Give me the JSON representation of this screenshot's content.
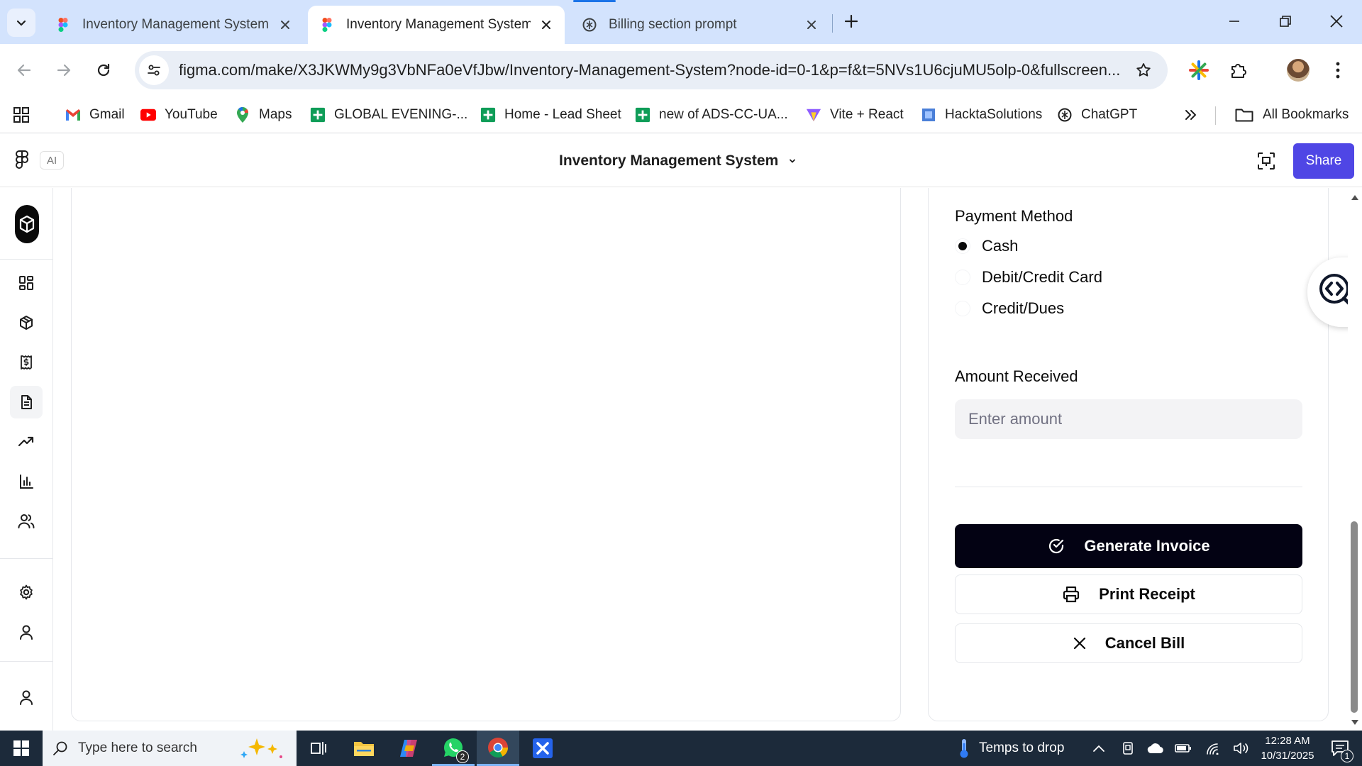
{
  "browser": {
    "tabs": [
      {
        "title": "Inventory Management System",
        "favicon": "figma-icon",
        "active": false
      },
      {
        "title": "Inventory Management System",
        "favicon": "figma-icon",
        "active": true
      },
      {
        "title": "Billing section prompt",
        "favicon": "chatgpt-icon",
        "active": false
      }
    ],
    "url": "figma.com/make/X3JKWMy9g3VbNFa0eVfJbw/Inventory-Management-System?node-id=0-1&p=f&t=5NVs1U6cjuMU5olp-0&fullscreen...",
    "bookmarks": [
      {
        "label": "Gmail",
        "icon": "gmail-icon"
      },
      {
        "label": "YouTube",
        "icon": "youtube-icon"
      },
      {
        "label": "Maps",
        "icon": "maps-icon"
      },
      {
        "label": "GLOBAL EVENING-...",
        "icon": "sheets-icon"
      },
      {
        "label": "Home - Lead Sheet",
        "icon": "sheets-icon"
      },
      {
        "label": "new of ADS-CC-UA...",
        "icon": "sheets-icon"
      },
      {
        "label": "Vite + React",
        "icon": "vite-icon"
      },
      {
        "label": "HacktaSolutions",
        "icon": "hackta-icon"
      },
      {
        "label": "ChatGPT",
        "icon": "chatgpt-icon"
      }
    ],
    "all_bookmarks_label": "All Bookmarks"
  },
  "figma": {
    "ai_badge": "AI",
    "project_title": "Inventory Management System",
    "share_label": "Share"
  },
  "billing": {
    "payment_method_label": "Payment Method",
    "payment_options": [
      {
        "label": "Cash",
        "selected": true
      },
      {
        "label": "Debit/Credit Card",
        "selected": false
      },
      {
        "label": "Credit/Dues",
        "selected": false
      }
    ],
    "amount_label": "Amount Received",
    "amount_placeholder": "Enter amount",
    "amount_value": "",
    "generate_invoice_label": "Generate Invoice",
    "print_receipt_label": "Print Receipt",
    "cancel_bill_label": "Cancel Bill"
  },
  "taskbar": {
    "search_placeholder": "Type here to search",
    "weather_text": "Temps to drop",
    "whatsapp_badge": "2",
    "time": "12:28 AM",
    "date": "10/31/2025",
    "notification_count": "1"
  },
  "colors": {
    "accent": "#4f46e5",
    "primary_button": "#030213",
    "tabstrip": "#d3e3fd",
    "taskbar": "#1c2a3a"
  }
}
